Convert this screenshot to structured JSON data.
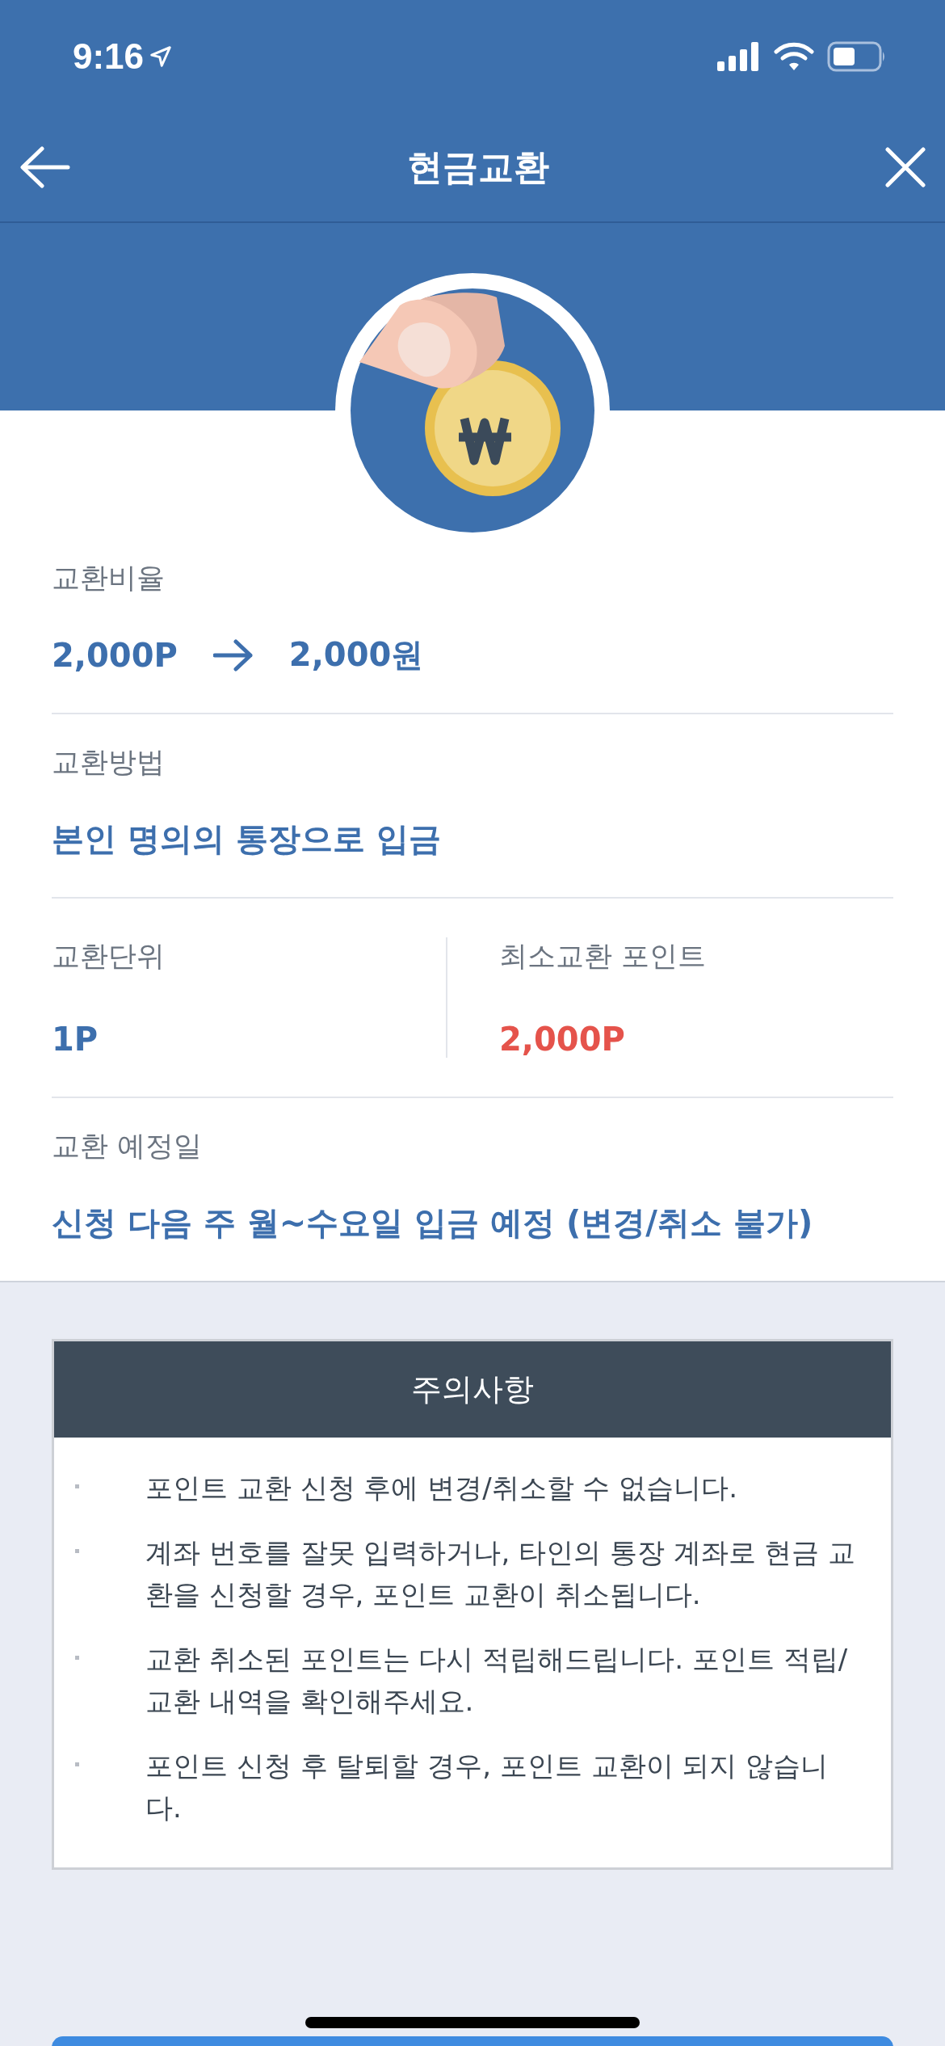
{
  "status_bar": {
    "time": "9:16"
  },
  "nav": {
    "title": "현금교환"
  },
  "sections": [
    {
      "kind": "rate",
      "label": "교환비율",
      "from": "2,000P",
      "to": "2,000원"
    },
    {
      "kind": "text",
      "label": "교환방법",
      "value": "본인 명의의 통장으로 입금"
    },
    {
      "kind": "split",
      "columns": [
        {
          "label": "교환단위",
          "value": "1P",
          "color": "#3d6fad"
        },
        {
          "label": "최소교환 포인트",
          "value": "2,000P",
          "color": "#e5534b"
        }
      ]
    },
    {
      "kind": "text",
      "label": "교환 예정일",
      "value": "신청 다음 주 월~수요일 입금 예정 (변경/취소 불가)"
    }
  ],
  "notice": {
    "title": "주의사항",
    "items": [
      "포인트 교환 신청 후에 변경/취소할 수 없습니다.",
      "계좌 번호를 잘못 입력하거나, 타인의 통장 계좌로 현금 교환을 신청할 경우, 포인트 교환이 취소됩니다.",
      "교환 취소된 포인트는 다시 적립해드립니다. 포인트 적립/교환 내역을 확인해주세요.",
      "포인트 신청 후 탈퇴할 경우, 포인트 교환이 되지 않습니다."
    ]
  }
}
